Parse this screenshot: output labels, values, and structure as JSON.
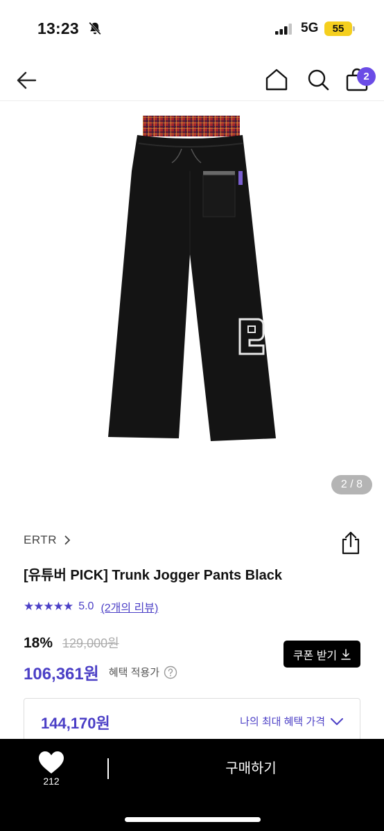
{
  "status": {
    "time": "13:23",
    "network": "5G",
    "battery": "55"
  },
  "nav": {
    "cart_count": "2"
  },
  "gallery": {
    "counter": "2 / 8"
  },
  "product": {
    "brand": "ERTR",
    "title": "[유튜버 PICK] Trunk Jogger Pants Black",
    "rating_stars": "★★★★★",
    "rating": "5.0",
    "review_link": "(2개의 리뷰)",
    "discount_rate": "18%",
    "original_price": "129,000원",
    "sale_price": "106,361원",
    "benefit_label": "혜택 적용가",
    "coupon_button": "쿠폰 받기",
    "max_price": "144,170원",
    "max_benefit_label": "나의 최대 혜택 가격"
  },
  "bottom_bar": {
    "like_count": "212",
    "buy_label": "구매하기"
  },
  "colors": {
    "accent": "#4b3fc6",
    "badge": "#6b4ce6",
    "battery": "#f5cf1e",
    "bottom_bar": "#000000"
  }
}
